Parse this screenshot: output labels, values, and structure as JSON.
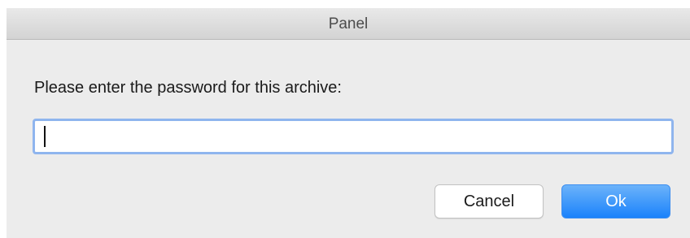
{
  "window": {
    "title": "Panel"
  },
  "dialog": {
    "prompt": "Please enter the password for this archive:",
    "password_value": "",
    "password_placeholder": ""
  },
  "buttons": {
    "cancel_label": "Cancel",
    "ok_label": "Ok"
  },
  "colors": {
    "dialog_background": "#ececec",
    "focus_ring": "#8fb5ee",
    "primary_button": "#1a82fb"
  }
}
